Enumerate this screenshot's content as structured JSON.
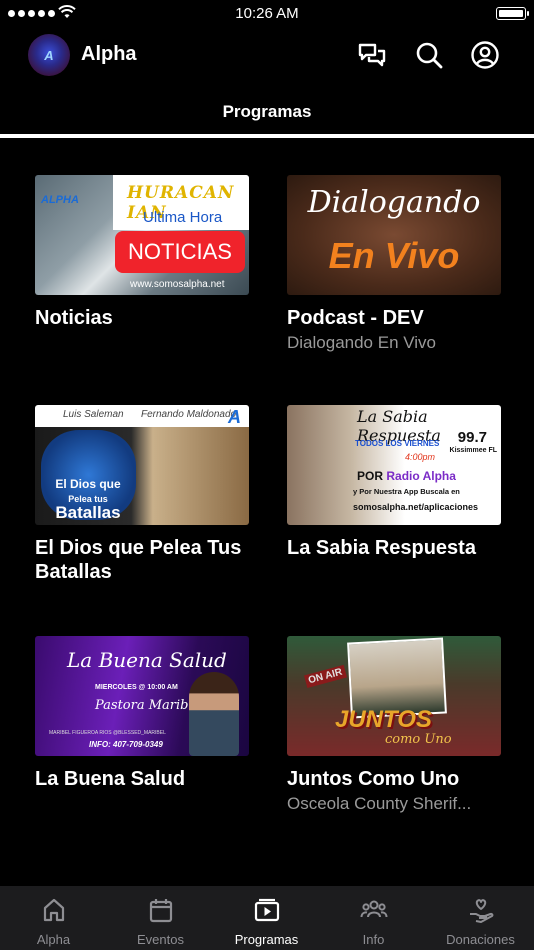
{
  "status_bar": {
    "time": "10:26 AM"
  },
  "header": {
    "title": "Alpha",
    "logo_text": "A"
  },
  "tabs": [
    {
      "label": "Programas",
      "active": true
    }
  ],
  "programs": [
    {
      "title": "Noticias",
      "subtitle": "",
      "thumbnail": {
        "logo": "ALPHA",
        "headline": "HURACAN IAN",
        "tagline": "Ultima Hora",
        "badge": "NOTICIAS",
        "url": "www.somosalpha.net"
      }
    },
    {
      "title": "Podcast - DEV",
      "subtitle": "Dialogando En Vivo",
      "thumbnail": {
        "line1": "Dialogando",
        "line2": "En Vivo"
      }
    },
    {
      "title": "El Dios que Pelea Tus Batallas",
      "subtitle": "",
      "thumbnail": {
        "name_left": "Luis Saleman",
        "name_right": "Fernando Maldonado",
        "logo": "A",
        "line1": "El Dios que",
        "line2": "Pelea tus",
        "line3": "Batallas"
      }
    },
    {
      "title": "La Sabia Respuesta",
      "subtitle": "",
      "thumbnail": {
        "title": "La Sabia Respuesta",
        "schedule": "TODOS LOS VIERNES",
        "time": "4:00pm",
        "frequency": "99.7",
        "location": "Kissimmee FL",
        "por": "POR",
        "station": "Radio Alpha",
        "line1": "y Por Nuestra App Buscala en",
        "line2": "somosalpha.net/aplicaciones"
      }
    },
    {
      "title": "La Buena Salud",
      "subtitle": "",
      "thumbnail": {
        "title": "La Buena Salud",
        "schedule": "MIERCOLES @ 10:00 AM",
        "host": "Pastora Maribel",
        "handles": "MARIBEL FIGUEROA RIOS  @BLESSED_MARIBEL",
        "info": "INFO: 407-709-0349"
      }
    },
    {
      "title": "Juntos Como Uno",
      "subtitle": "Osceola County Sherif...",
      "thumbnail": {
        "badge": "ON AIR",
        "word": "JUNTOS",
        "script": "como Uno"
      }
    }
  ],
  "bottom_nav": [
    {
      "label": "Alpha",
      "icon": "home-icon",
      "active": false
    },
    {
      "label": "Eventos",
      "icon": "calendar-icon",
      "active": false
    },
    {
      "label": "Programas",
      "icon": "play-screen-icon",
      "active": true
    },
    {
      "label": "Info",
      "icon": "group-icon",
      "active": false
    },
    {
      "label": "Donaciones",
      "icon": "donate-hand-icon",
      "active": false
    }
  ]
}
